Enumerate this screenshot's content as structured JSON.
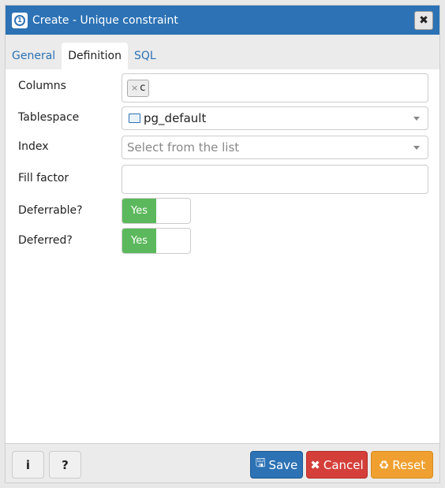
{
  "dialog": {
    "title": "Create - Unique constraint",
    "title_icon": "unique-constraint-icon",
    "close_label": "✖"
  },
  "tabs": [
    {
      "label": "General",
      "active": false
    },
    {
      "label": "Definition",
      "active": true
    },
    {
      "label": "SQL",
      "active": false
    }
  ],
  "form": {
    "columns": {
      "label": "Columns",
      "chips": [
        {
          "remove": "×",
          "value": "c"
        }
      ]
    },
    "tablespace": {
      "label": "Tablespace",
      "value": "pg_default",
      "icon": "folder-icon"
    },
    "index": {
      "label": "Index",
      "placeholder": "Select from the list"
    },
    "fill_factor": {
      "label": "Fill factor",
      "value": ""
    },
    "deferrable": {
      "label": "Deferrable?",
      "on_label": "Yes",
      "checked": true
    },
    "deferred": {
      "label": "Deferred?",
      "on_label": "Yes",
      "checked": true
    }
  },
  "footer": {
    "info_label": "i",
    "help_label": "?",
    "save_label": "Save",
    "cancel_label": "Cancel",
    "reset_label": "Reset",
    "colors": {
      "save": "#2c72b5",
      "cancel": "#d43f3a",
      "reset": "#f0a030",
      "toggle_on": "#5cb85c"
    }
  }
}
